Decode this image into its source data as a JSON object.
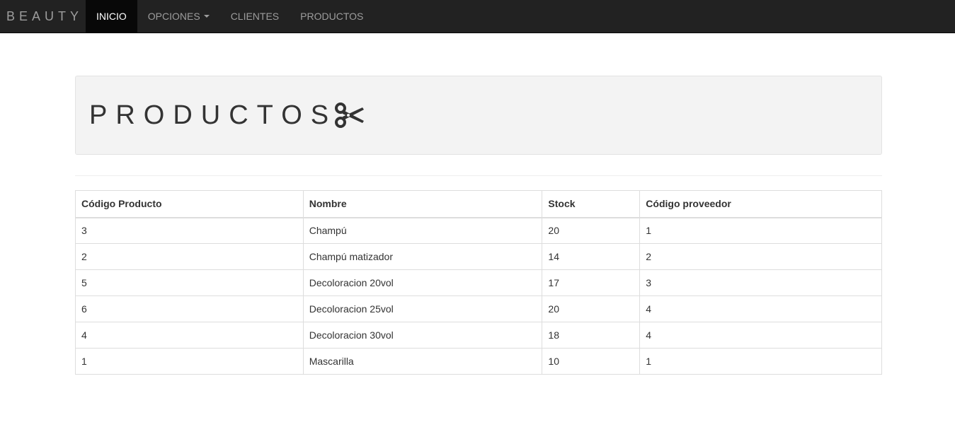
{
  "navbar": {
    "brand": "BEAUTY",
    "items": [
      {
        "label": "INICIO",
        "active": true
      },
      {
        "label": "OPCIONES",
        "dropdown": true
      },
      {
        "label": "CLIENTES"
      },
      {
        "label": "PRODUCTOS"
      }
    ]
  },
  "page": {
    "title": "PRODUCTOS",
    "title_icon": "scissors-icon"
  },
  "table": {
    "headers": [
      "Código Producto",
      "Nombre",
      "Stock",
      "Código proveedor"
    ],
    "rows": [
      [
        "3",
        "Champú",
        "20",
        "1"
      ],
      [
        "2",
        "Champú matizador",
        "14",
        "2"
      ],
      [
        "5",
        "Decoloracion 20vol",
        "17",
        "3"
      ],
      [
        "6",
        "Decoloracion 25vol",
        "20",
        "4"
      ],
      [
        "4",
        "Decoloracion 30vol",
        "18",
        "4"
      ],
      [
        "1",
        "Mascarilla",
        "10",
        "1"
      ]
    ]
  }
}
